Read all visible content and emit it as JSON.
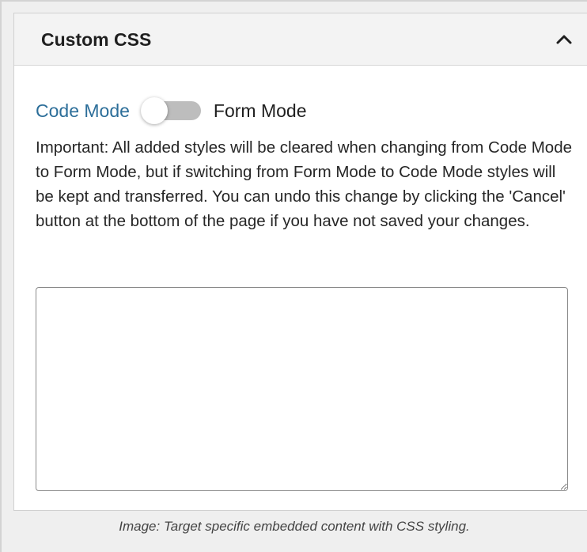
{
  "panel": {
    "title": "Custom CSS",
    "collapse_icon": "chevron-up-icon"
  },
  "mode_switch": {
    "left_label": "Code Mode",
    "right_label": "Form Mode",
    "state": "code",
    "accent_color": "#2c6e99"
  },
  "notice": {
    "text": "Important: All added styles will be cleared when changing from Code Mode to Form Mode, but if switching from Form Mode to Code Mode styles will be kept and transferred. You can undo this change by clicking the 'Cancel' button at the bottom of the page if you have not saved your changes."
  },
  "css_editor": {
    "value": "",
    "placeholder": ""
  },
  "caption": {
    "text": "Image: Target specific embedded content with CSS styling."
  }
}
